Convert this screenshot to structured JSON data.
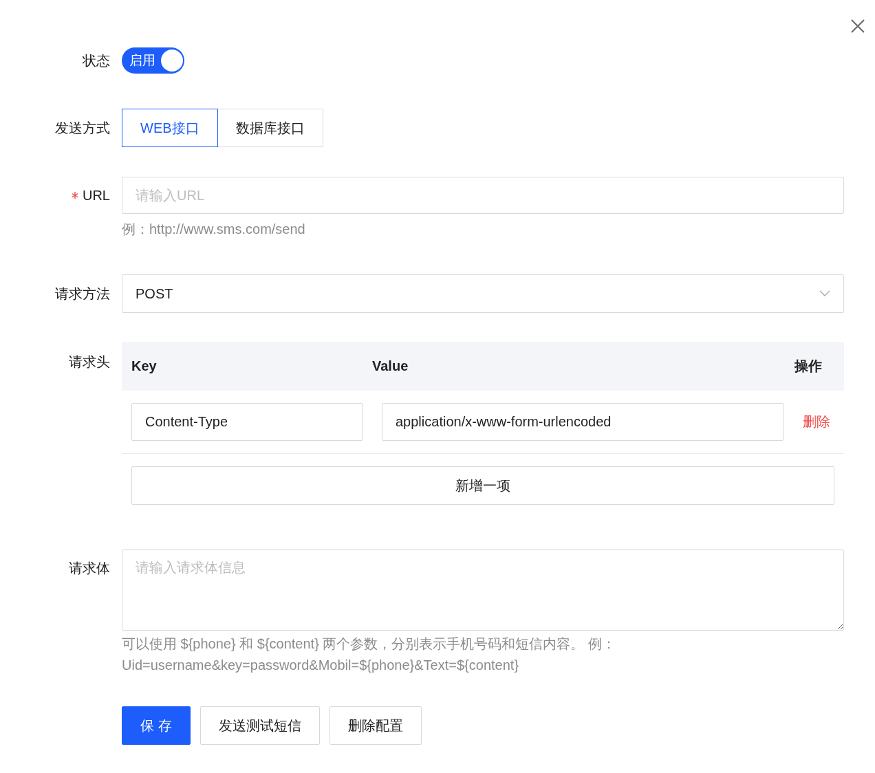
{
  "status": {
    "label": "状态",
    "on": true,
    "text": "启用"
  },
  "send_mode": {
    "label": "发送方式",
    "options": [
      {
        "label": "WEB接口",
        "selected": true
      },
      {
        "label": "数据库接口",
        "selected": false
      }
    ]
  },
  "url": {
    "label": "URL",
    "required": true,
    "placeholder": "请输入URL",
    "hint": "例：http://www.sms.com/send"
  },
  "method": {
    "label": "请求方法",
    "value": "POST"
  },
  "headers": {
    "label": "请求头",
    "columns": [
      "Key",
      "Value",
      "操作"
    ],
    "rows": [
      {
        "key": "Content-Type",
        "value": "application/x-www-form-urlencoded",
        "action": "删除"
      }
    ],
    "add_button": "新增一项"
  },
  "body": {
    "label": "请求体",
    "placeholder": "请输入请求体信息",
    "hint": "可以使用 ${phone} 和 ${content} 两个参数，分别表示手机号码和短信内容。 例： Uid=username&key=password&Mobil=${phone}&Text=${content}"
  },
  "buttons": [
    {
      "label": "保 存",
      "kind": "primary"
    },
    {
      "label": "发送测试短信",
      "kind": "default"
    },
    {
      "label": "删除配置",
      "kind": "default"
    }
  ]
}
